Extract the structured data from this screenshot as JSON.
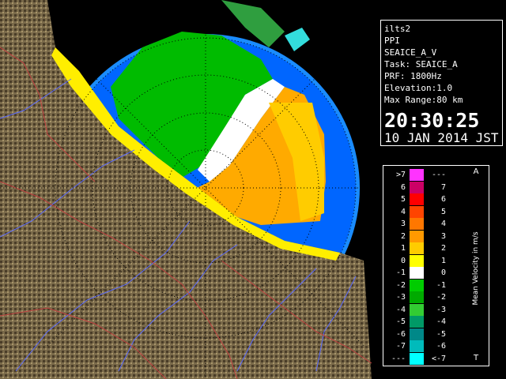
{
  "info": {
    "site": "ilts2",
    "product": "PPI",
    "dataset": "SEAICE_A_V",
    "task": "Task: SEAICE_A",
    "prf": "PRF: 1800Hz",
    "elevation": "Elevation:1.0",
    "max_range": "Max Range:80 km",
    "time": "20:30:25",
    "date": "10 JAN 2014 JST"
  },
  "legend": {
    "title": "Mean Velocity in m/s",
    "top_letter": "A",
    "bottom_letter": "T",
    "rows": [
      {
        "left": ">7",
        "right": "---",
        "color": "#ff33ff"
      },
      {
        "left": "6",
        "right": "7",
        "color": "#cc0066"
      },
      {
        "left": "5",
        "right": "6",
        "color": "#ff0000"
      },
      {
        "left": "4",
        "right": "5",
        "color": "#ff4400"
      },
      {
        "left": "3",
        "right": "4",
        "color": "#ff7700"
      },
      {
        "left": "2",
        "right": "3",
        "color": "#ff9900"
      },
      {
        "left": "1",
        "right": "2",
        "color": "#ffcc00"
      },
      {
        "left": "0",
        "right": "1",
        "color": "#ffff00"
      },
      {
        "left": "-1",
        "right": "0",
        "color": "#ffffff"
      },
      {
        "left": "-2",
        "right": "-1",
        "color": "#00cc00"
      },
      {
        "left": "-3",
        "right": "-2",
        "color": "#00aa00"
      },
      {
        "left": "-4",
        "right": "-3",
        "color": "#33cc33"
      },
      {
        "left": "-5",
        "right": "-4",
        "color": "#009966"
      },
      {
        "left": "-6",
        "right": "-5",
        "color": "#008888"
      },
      {
        "left": "-7",
        "right": "-6",
        "color": "#00bbbb"
      },
      {
        "left": "---",
        "right": "<-7",
        "color": "#00ffff"
      }
    ]
  },
  "colors": {
    "sea": "#0066ff",
    "coverage": "#1a8cff",
    "land": "#7a6a4a",
    "rivers": "#5a6aff",
    "boundaries": "#c04040",
    "approach": "#00bb00",
    "recede": "#ffaa00"
  }
}
